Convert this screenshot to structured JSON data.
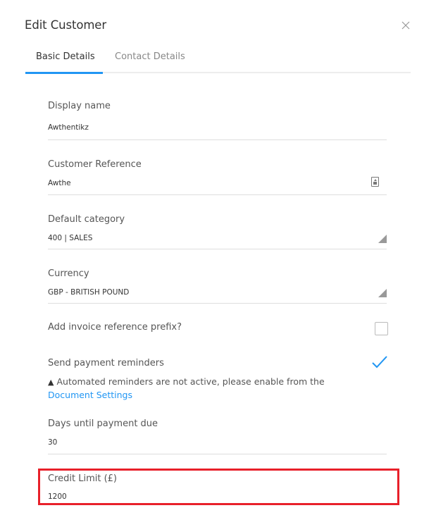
{
  "dialog": {
    "title": "Edit Customer",
    "close_icon": "close-icon"
  },
  "tabs": [
    {
      "label": "Basic Details",
      "active": true
    },
    {
      "label": "Contact Details",
      "active": false
    }
  ],
  "fields": {
    "display_name": {
      "label": "Display name",
      "value": "Awthentikz"
    },
    "customer_reference": {
      "label": "Customer Reference",
      "value": "Awthe",
      "icon": "reference-generator-icon"
    },
    "default_category": {
      "label": "Default category",
      "value": "400 | SALES"
    },
    "currency": {
      "label": "Currency",
      "value": "GBP - BRITISH POUND"
    },
    "invoice_prefix": {
      "label": "Add invoice reference prefix?",
      "checked": false
    },
    "payment_reminders": {
      "label": "Send payment reminders",
      "checked": true,
      "warning_icon": "warning-icon",
      "warning_text": "Automated reminders are not active, please enable from the ",
      "warning_link": "Document Settings"
    },
    "days_until_due": {
      "label": "Days until payment due",
      "value": "30"
    },
    "credit_limit": {
      "label": "Credit Limit (£)",
      "value": "1200",
      "highlighted": true
    }
  },
  "colors": {
    "accent": "#2196f3",
    "highlight": "#e8202a"
  }
}
